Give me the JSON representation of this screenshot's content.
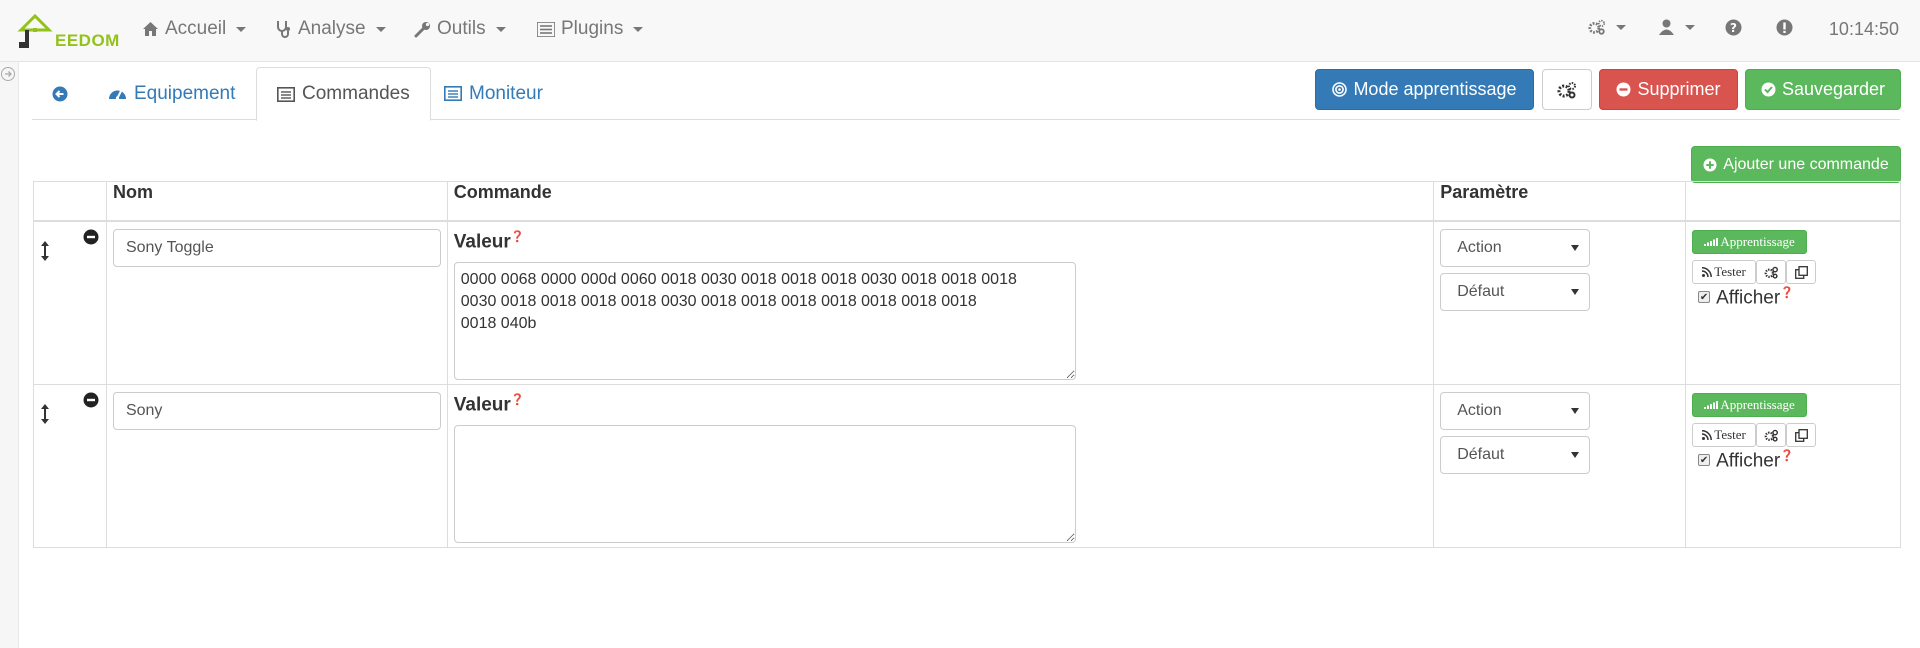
{
  "navbar": {
    "logo_text_first": "J",
    "logo_text_rest": "EEDOM",
    "menu": [
      {
        "label": "Accueil",
        "icon": "home-icon"
      },
      {
        "label": "Analyse",
        "icon": "stethoscope-icon"
      },
      {
        "label": "Outils",
        "icon": "wrench-icon"
      },
      {
        "label": "Plugins",
        "icon": "tasks-icon"
      }
    ],
    "right_icons": [
      "gears-icon",
      "user-icon",
      "question-icon",
      "exclamation-icon"
    ],
    "clock": "10:14:50"
  },
  "tabs": [
    {
      "label": "",
      "icon": "arrow-circle-left-icon"
    },
    {
      "label": "Equipement",
      "icon": "tachometer-icon"
    },
    {
      "label": "Commandes",
      "icon": "list-alt-icon",
      "active": true
    },
    {
      "label": "Moniteur",
      "icon": "list-alt-icon"
    }
  ],
  "actions": {
    "learn": "Mode apprentissage",
    "delete": "Supprimer",
    "save": "Sauvegarder",
    "add_command": "Ajouter une commande"
  },
  "table": {
    "headers": [
      "",
      "Nom",
      "Commande",
      "Paramètre",
      ""
    ],
    "rows": [
      {
        "name": "Sony Toggle",
        "value_label": "Valeur",
        "value": "0000 0068 0000 000d 0060 0018 0030 0018 0018 0018 0030 0018 0018 0018\n0030 0018 0018 0018 0018 0030 0018 0018 0018 0018 0018 0018 0018\n0018 040b",
        "type": "Action",
        "subtype": "Défaut",
        "learn_btn": "Apprentissage",
        "test_btn": "Tester",
        "show_label": "Afficher",
        "show_checked": true
      },
      {
        "name": "Sony",
        "value_label": "Valeur",
        "value": "",
        "type": "Action",
        "subtype": "Défaut",
        "learn_btn": "Apprentissage",
        "test_btn": "Tester",
        "show_label": "Afficher",
        "show_checked": true
      }
    ]
  },
  "colors": {
    "primary": "#337ab7",
    "danger": "#d9534f",
    "success": "#5cb85c",
    "logo_green": "#93c21a"
  }
}
